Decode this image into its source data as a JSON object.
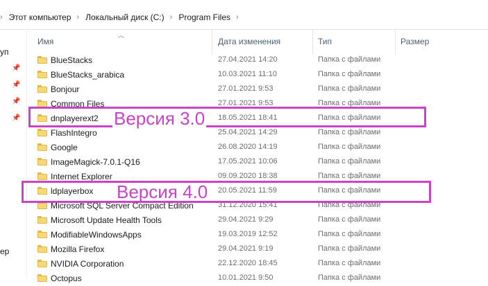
{
  "breadcrumb": {
    "items": [
      "Этот компьютер",
      "Локальный диск (C:)",
      "Program Files"
    ],
    "separator": "›"
  },
  "nav": {
    "labels": [
      "уп",
      "ер"
    ]
  },
  "columns": {
    "name": "Имя",
    "date": "Дата изменения",
    "type": "Тип",
    "size": "Размер"
  },
  "rows": [
    {
      "name": "BlueStacks",
      "date": "27.04.2021 14:20",
      "type": "Папка с файлами"
    },
    {
      "name": "BlueStacks_arabica",
      "date": "10.03.2021 11:10",
      "type": "Папка с файлами"
    },
    {
      "name": "Bonjour",
      "date": "27.01.2021 9:53",
      "type": "Папка с файлами"
    },
    {
      "name": "Common Files",
      "date": "27.01.2021 9:53",
      "type": "Папка с файлами"
    },
    {
      "name": "dnplayerext2",
      "date": "18.05.2021 18:41",
      "type": "Папка с файлами"
    },
    {
      "name": "FlashIntegro",
      "date": "25.04.2021 14:29",
      "type": "Папка с файлами"
    },
    {
      "name": "Google",
      "date": "26.08.2020 14:19",
      "type": "Папка с файлами"
    },
    {
      "name": "ImageMagick-7.0.1-Q16",
      "date": "17.05.2021 10:06",
      "type": "Папка с файлами"
    },
    {
      "name": "Internet Explorer",
      "date": "09.09.2020 18:38",
      "type": "Папка с файлами"
    },
    {
      "name": "ldplayerbox",
      "date": "20.05.2021 11:59",
      "type": "Папка с файлами"
    },
    {
      "name": "Microsoft SQL Server Compact Edition",
      "date": "31.12.2020 15:41",
      "type": "Папка с файлами"
    },
    {
      "name": "Microsoft Update Health Tools",
      "date": "29.04.2021 9:29",
      "type": "Папка с файлами"
    },
    {
      "name": "ModifiableWindowsApps",
      "date": "19.03.2019 12:52",
      "type": "Папка с файлами"
    },
    {
      "name": "Mozilla Firefox",
      "date": "29.04.2021 9:19",
      "type": "Папка с файлами"
    },
    {
      "name": "NVIDIA Corporation",
      "date": "22.12.2020 18:45",
      "type": "Папка с файлами"
    },
    {
      "name": "Octopus",
      "date": "10.01.2021 9:50",
      "type": "Папка с файлами"
    }
  ],
  "annotations": [
    {
      "label": "Версия 3.0",
      "target": "dnplayerext2"
    },
    {
      "label": "Версия 4.0",
      "target": "ldplayerbox"
    }
  ],
  "colors": {
    "annotation": "#c843c8",
    "folder": "#f8d775",
    "header_text": "#4c607a"
  }
}
